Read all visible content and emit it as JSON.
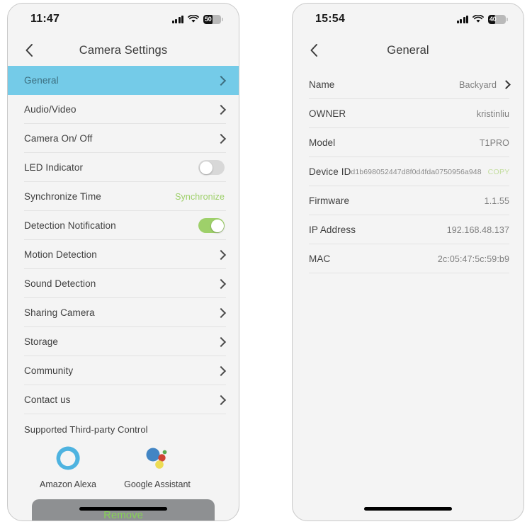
{
  "left_phone": {
    "status": {
      "time": "11:47",
      "cellular_icon": "cellular-bars-icon",
      "wifi_icon": "wifi-icon",
      "battery_level": "50",
      "battery_percent": 50
    },
    "nav": {
      "back_icon": "chevron-left-icon",
      "title": "Camera Settings"
    },
    "rows": [
      {
        "label": "General",
        "type": "chevron",
        "highlighted": true
      },
      {
        "label": "Audio/Video",
        "type": "chevron",
        "highlighted": false
      },
      {
        "label": "Camera On/ Off",
        "type": "chevron",
        "highlighted": false
      },
      {
        "label": "LED Indicator",
        "type": "toggle",
        "toggle_on": false,
        "highlighted": false
      },
      {
        "label": "Synchronize Time",
        "type": "action",
        "action_label": "Synchronize",
        "highlighted": false
      },
      {
        "label": "Detection Notification",
        "type": "toggle",
        "toggle_on": true,
        "highlighted": false
      },
      {
        "label": "Motion Detection",
        "type": "chevron",
        "highlighted": false
      },
      {
        "label": "Sound Detection",
        "type": "chevron",
        "highlighted": false
      },
      {
        "label": "Sharing Camera",
        "type": "chevron",
        "highlighted": false
      },
      {
        "label": "Storage",
        "type": "chevron",
        "highlighted": false
      },
      {
        "label": "Community",
        "type": "chevron",
        "highlighted": false
      },
      {
        "label": "Contact us",
        "type": "chevron",
        "highlighted": false
      }
    ],
    "third_party": {
      "title": "Supported Third-party Control",
      "items": [
        {
          "name": "Amazon Alexa",
          "icon": "amazon-alexa-icon"
        },
        {
          "name": "Google Assistant",
          "icon": "google-assistant-icon"
        }
      ]
    },
    "remove_button": {
      "label": "Remove"
    },
    "colors": {
      "highlight": "#74cbe8",
      "toggle_on": "#9ed06a",
      "action_link": "#9ed06a",
      "remove_bg": "#8e9092",
      "remove_text": "#86d155"
    }
  },
  "right_phone": {
    "status": {
      "time": "15:54",
      "cellular_icon": "cellular-bars-icon",
      "wifi_icon": "wifi-icon",
      "battery_level": "40",
      "battery_percent": 40
    },
    "nav": {
      "back_icon": "chevron-left-icon",
      "title": "General"
    },
    "rows": [
      {
        "key": "Name",
        "value": "Backyard",
        "has_chevron": true
      },
      {
        "key": "OWNER",
        "value": "kristinliu",
        "has_chevron": false
      },
      {
        "key": "Model",
        "value": "T1PRO",
        "has_chevron": false
      },
      {
        "key": "Device ID",
        "value": "d1b698052447d8f0d4fda0750956a948",
        "has_chevron": false,
        "copy_label": "COPY",
        "monospace": true
      },
      {
        "key": "Firmware",
        "value": "1.1.55",
        "has_chevron": false
      },
      {
        "key": "IP Address",
        "value": "192.168.48.137",
        "has_chevron": false
      },
      {
        "key": "MAC",
        "value": "2c:05:47:5c:59:b9",
        "has_chevron": false
      }
    ],
    "colors": {
      "copy_link": "#c2dd9c"
    }
  }
}
